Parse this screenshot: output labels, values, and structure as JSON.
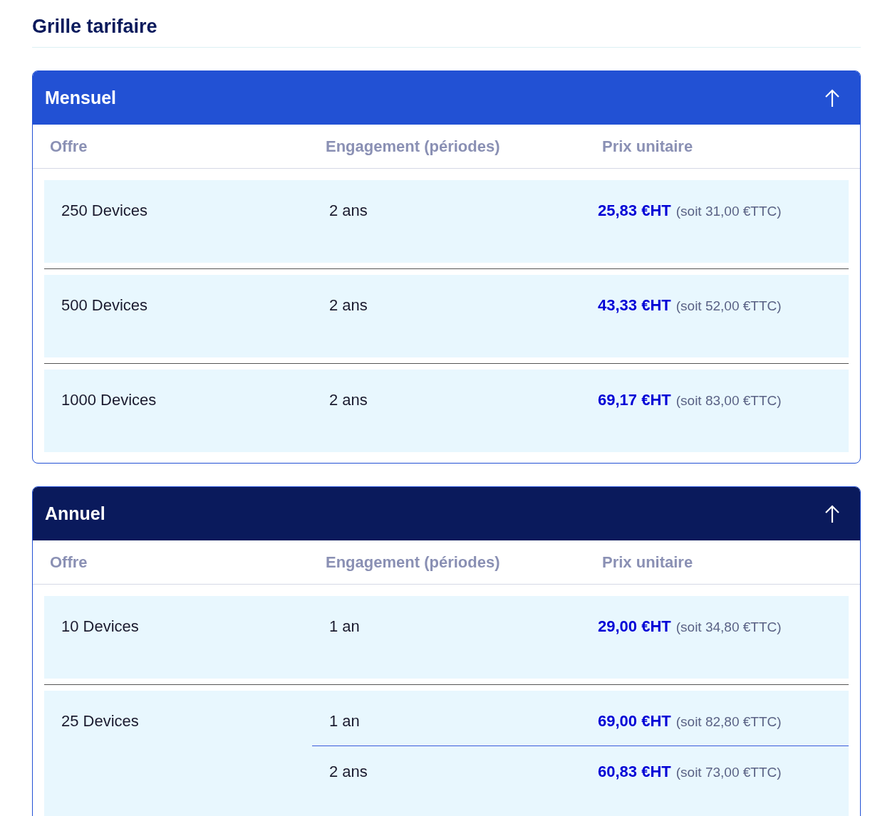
{
  "title": "Grille tarifaire",
  "sections": [
    {
      "title": "Mensuel",
      "color": "#2251d4",
      "columns": [
        "Offre",
        "Engagement (périodes)",
        "Prix unitaire"
      ],
      "rows": [
        {
          "offer": "250 Devices",
          "terms": [
            {
              "duration": "2 ans",
              "price_ht": "25,83 €HT",
              "price_ttc": "(soit 31,00 €TTC)"
            }
          ]
        },
        {
          "offer": "500 Devices",
          "terms": [
            {
              "duration": "2 ans",
              "price_ht": "43,33 €HT",
              "price_ttc": "(soit 52,00 €TTC)"
            }
          ]
        },
        {
          "offer": "1000 Devices",
          "terms": [
            {
              "duration": "2 ans",
              "price_ht": "69,17 €HT",
              "price_ttc": "(soit 83,00 €TTC)"
            }
          ]
        }
      ]
    },
    {
      "title": "Annuel",
      "color": "#0a1a5c",
      "columns": [
        "Offre",
        "Engagement (périodes)",
        "Prix unitaire"
      ],
      "rows": [
        {
          "offer": "10 Devices",
          "terms": [
            {
              "duration": "1 an",
              "price_ht": "29,00 €HT",
              "price_ttc": "(soit 34,80 €TTC)"
            }
          ]
        },
        {
          "offer": "25 Devices",
          "terms": [
            {
              "duration": "1 an",
              "price_ht": "69,00 €HT",
              "price_ttc": "(soit 82,80 €TTC)"
            },
            {
              "duration": "2 ans",
              "price_ht": "60,83 €HT",
              "price_ttc": "(soit 73,00 €TTC)"
            }
          ]
        }
      ]
    }
  ]
}
